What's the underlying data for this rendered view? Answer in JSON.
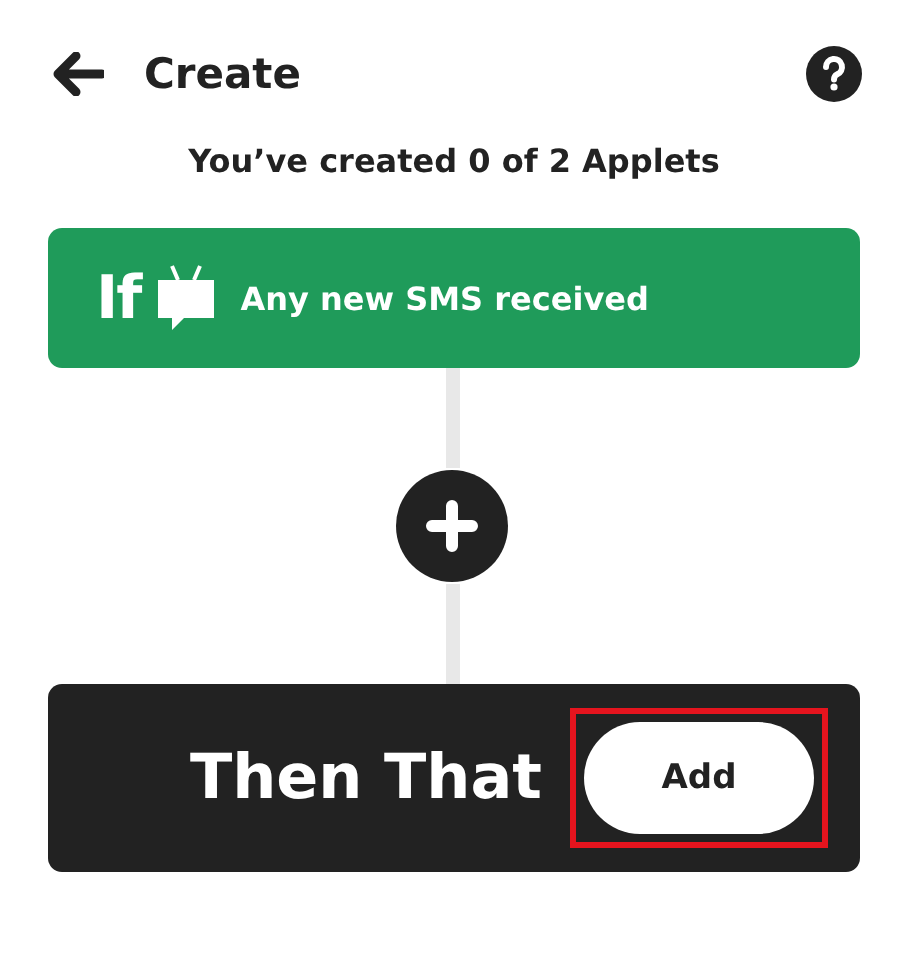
{
  "header": {
    "title": "Create"
  },
  "subtitle": "You’ve created 0 of 2 Applets",
  "trigger": {
    "prefix": "If",
    "text": "Any new SMS received"
  },
  "action": {
    "label": "Then That",
    "button": {
      "label": "Add",
      "highlighted": true
    }
  }
}
